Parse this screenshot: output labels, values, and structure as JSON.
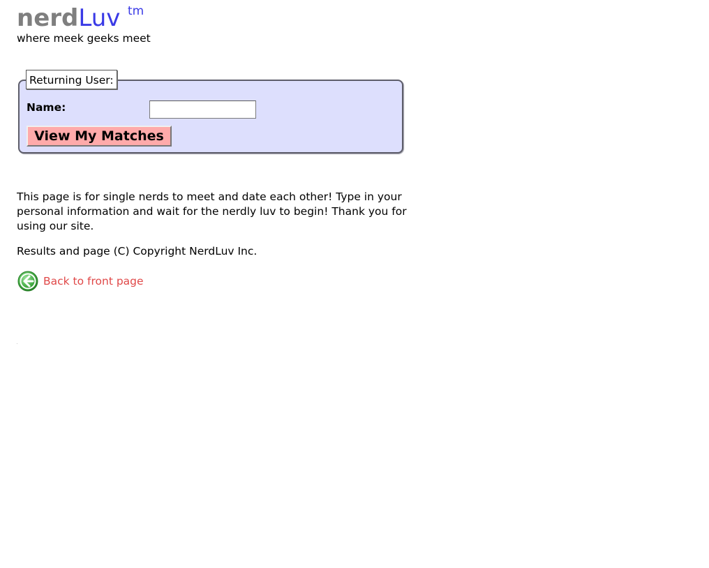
{
  "header": {
    "logo_nerd": "nerd",
    "logo_luv": "Luv",
    "logo_tm": "tm",
    "tagline": "where meek geeks meet"
  },
  "login_form": {
    "legend": "Returning User:",
    "name_label": "Name:",
    "name_value": "",
    "submit_label": "View My Matches"
  },
  "content": {
    "intro_text": "This page is for single nerds to meet and date each other! Type in your personal information and wait for the nerdly luv to begin! Thank you for using our site.",
    "copyright": "Results and page (C) Copyright NerdLuv Inc.",
    "back_link": "Back to front page"
  },
  "icons": {
    "back": "back-arrow-icon"
  },
  "colors": {
    "logo_gray": "#7f7f7f",
    "logo_blue": "#3a3ae6",
    "fieldset_bg": "#dddffd",
    "button_bg": "#ffaaaa",
    "link_color": "#e04848",
    "icon_green": "#3fa33f"
  }
}
